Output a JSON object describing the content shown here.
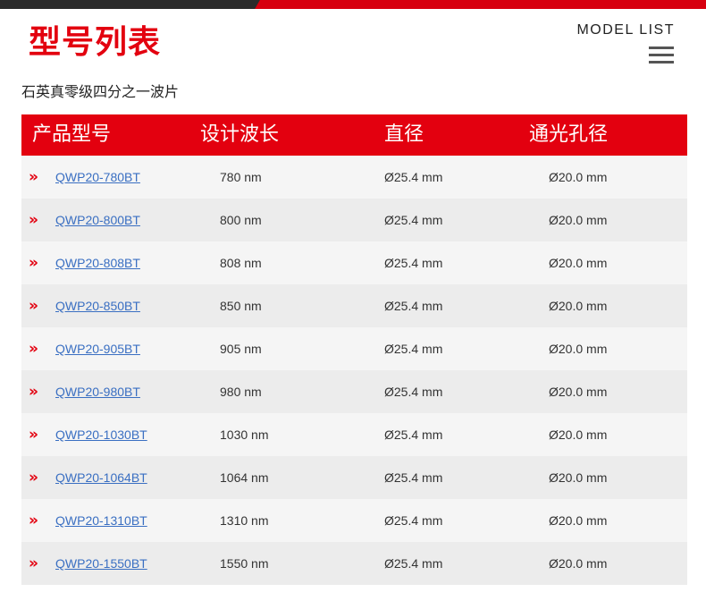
{
  "header": {
    "title": "型号列表",
    "model_list": "MODEL LIST",
    "menu_icon": "hamburger-menu-icon"
  },
  "subtitle": "石英真零级四分之一波片",
  "colors": {
    "accent": "#e3000f",
    "link": "#3a6fc2",
    "topbar_dark": "#2b2b2b"
  },
  "table": {
    "headers": [
      "产品型号",
      "设计波长",
      "直径",
      "通光孔径"
    ],
    "rows": [
      {
        "bullet": "»",
        "model": "QWP20-780BT",
        "wavelength": "780 nm",
        "diameter": "Ø25.4 mm",
        "aperture": "Ø20.0 mm"
      },
      {
        "bullet": "»",
        "model": "QWP20-800BT",
        "wavelength": "800 nm",
        "diameter": "Ø25.4 mm",
        "aperture": "Ø20.0 mm"
      },
      {
        "bullet": "»",
        "model": "QWP20-808BT",
        "wavelength": "808 nm",
        "diameter": "Ø25.4 mm",
        "aperture": "Ø20.0 mm"
      },
      {
        "bullet": "»",
        "model": "QWP20-850BT",
        "wavelength": "850 nm",
        "diameter": "Ø25.4 mm",
        "aperture": "Ø20.0 mm"
      },
      {
        "bullet": "»",
        "model": "QWP20-905BT",
        "wavelength": "905 nm",
        "diameter": "Ø25.4 mm",
        "aperture": "Ø20.0 mm"
      },
      {
        "bullet": "»",
        "model": "QWP20-980BT",
        "wavelength": "980 nm",
        "diameter": "Ø25.4 mm",
        "aperture": "Ø20.0 mm"
      },
      {
        "bullet": "»",
        "model": "QWP20-1030BT",
        "wavelength": "1030 nm",
        "diameter": "Ø25.4 mm",
        "aperture": "Ø20.0 mm"
      },
      {
        "bullet": "»",
        "model": "QWP20-1064BT",
        "wavelength": "1064 nm",
        "diameter": "Ø25.4 mm",
        "aperture": "Ø20.0 mm"
      },
      {
        "bullet": "»",
        "model": "QWP20-1310BT",
        "wavelength": "1310 nm",
        "diameter": "Ø25.4 mm",
        "aperture": "Ø20.0 mm"
      },
      {
        "bullet": "»",
        "model": "QWP20-1550BT",
        "wavelength": "1550 nm",
        "diameter": "Ø25.4 mm",
        "aperture": "Ø20.0 mm"
      }
    ]
  }
}
